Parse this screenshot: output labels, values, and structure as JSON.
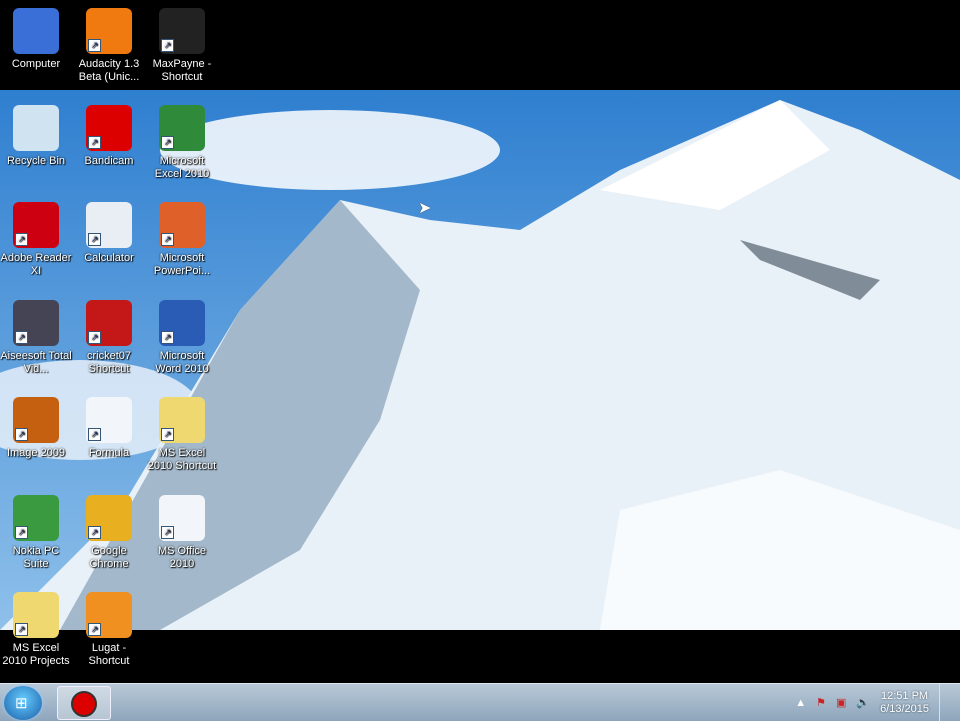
{
  "desktop_icons": [
    {
      "label": "Computer",
      "color": "#3a6fd8"
    },
    {
      "label": "Audacity 1.3 Beta (Unic...",
      "color": "#f07a10"
    },
    {
      "label": "MaxPayne - Shortcut",
      "color": "#222"
    },
    {
      "label": "Recycle Bin",
      "color": "#cfe3f0"
    },
    {
      "label": "Bandicam",
      "color": "#d00"
    },
    {
      "label": "Microsoft Excel 2010",
      "color": "#2f8a3a"
    },
    {
      "label": "Adobe Reader XI",
      "color": "#c01"
    },
    {
      "label": "Calculator",
      "color": "#e8eef4"
    },
    {
      "label": "Microsoft PowerPoi...",
      "color": "#e0602a"
    },
    {
      "label": "Aiseesoft Total Vid...",
      "color": "#445"
    },
    {
      "label": "cricket07 Shortcut",
      "color": "#c41818"
    },
    {
      "label": "Microsoft Word 2010",
      "color": "#2a5bb5"
    },
    {
      "label": "Image 2009",
      "color": "#c56010"
    },
    {
      "label": "Formula",
      "color": "#f2f5fa"
    },
    {
      "label": "MS Excel 2010 Shortcut",
      "color": "#f0d870"
    },
    {
      "label": "Nokia PC Suite",
      "color": "#3a9a40"
    },
    {
      "label": "Google Chrome",
      "color": "#e8b020"
    },
    {
      "label": "MS Office 2010",
      "color": "#f2f5fa"
    },
    {
      "label": "MS Excel 2010 Projects",
      "color": "#f0d870"
    },
    {
      "label": "Lugat - Shortcut",
      "color": "#f09020"
    }
  ],
  "taskbar": {
    "start_label": "Start",
    "running_app": "Bandicam"
  },
  "tray": {
    "time": "12:51 PM",
    "date": "6/13/2015"
  }
}
